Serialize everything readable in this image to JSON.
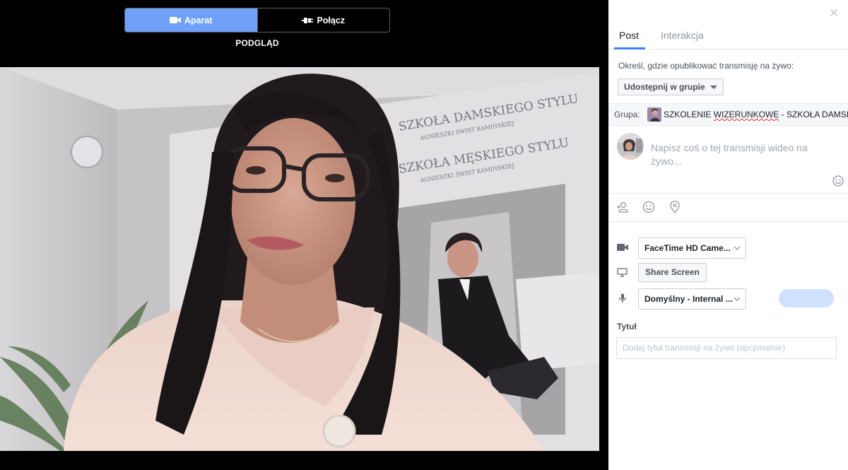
{
  "preview": {
    "tabs": [
      {
        "label": "Aparat",
        "active": true,
        "icon": "video-camera-icon"
      },
      {
        "label": "Połącz",
        "active": false,
        "icon": "plug-icon"
      }
    ],
    "label": "PODGLĄD",
    "poster_text": [
      "SZKOŁA DAMSKIEGO STYLU",
      "AGNIESZKI ŚWIST KAMIŃSKIEJ",
      "SZKOŁA MĘSKIEGO STYLU",
      "AGNIESZKI ŚWIST KAMIŃSKIEJ"
    ]
  },
  "panel": {
    "tabs": [
      {
        "label": "Post",
        "active": true
      },
      {
        "label": "Interakcja",
        "active": false
      }
    ],
    "where_label": "Określ, gdzie opublikować transmisję na żywo:",
    "share_select": "Udostępnij w grupie",
    "group": {
      "label": "Grupa:",
      "name_before": "SZKOLENIE ",
      "name_spell": "WIZERUNKOWE",
      "name_after": " - SZKOŁA DAMSKI"
    },
    "composer_placeholder": "Napisz coś o tej transmisji wideo na żywo...",
    "camera_select": "FaceTime HD Came...",
    "share_screen": "Share Screen",
    "mic_select": "Domyślny - Internal ...",
    "title_label": "Tytuł",
    "title_placeholder": "Dodaj tytuł transmisji na żywo (opcjonalnie)"
  },
  "colors": {
    "accent": "#4080ff",
    "active_tab_bg": "#6ea1f7",
    "go_button": "#cfe1fd"
  }
}
